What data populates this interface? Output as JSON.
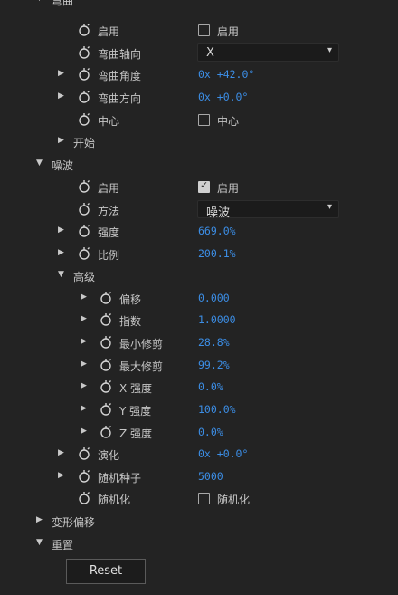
{
  "top_cut_label": "弯曲",
  "warp": {
    "enable_label": "启用",
    "enable_cb_label": "启用",
    "axis_label": "弯曲轴向",
    "axis_value": "X",
    "angle_label": "弯曲角度",
    "angle_value": "0x +42.0°",
    "direction_label": "弯曲方向",
    "direction_value": "0x +0.0°",
    "center_label": "中心",
    "center_cb_label": "中心",
    "start_label": "开始"
  },
  "noise": {
    "section_label": "噪波",
    "enable_label": "启用",
    "enable_cb_label": "启用",
    "enable_checked": true,
    "method_label": "方法",
    "method_value": "噪波",
    "strength_label": "强度",
    "strength_value": "669.0%",
    "scale_label": "比例",
    "scale_value": "200.1%",
    "advanced_label": "高级",
    "advanced": [
      {
        "label": "偏移",
        "value": "0.000"
      },
      {
        "label": "指数",
        "value": "1.0000"
      },
      {
        "label": "最小修剪",
        "value": "28.8%"
      },
      {
        "label": "最大修剪",
        "value": "99.2%"
      },
      {
        "label": "X 强度",
        "value": "0.0%"
      },
      {
        "label": "Y 强度",
        "value": "100.0%"
      },
      {
        "label": "Z 强度",
        "value": "0.0%"
      }
    ],
    "evolution_label": "演化",
    "evolution_value": "0x +0.0°",
    "seed_label": "随机种子",
    "seed_value": "5000",
    "randomize_label": "随机化",
    "randomize_cb_label": "随机化"
  },
  "transform_offset_label": "变形偏移",
  "overlay_label": "重置",
  "reset_button_label": "Reset",
  "colors": {
    "value_blue": "#3c8ee6",
    "background": "#232323"
  }
}
